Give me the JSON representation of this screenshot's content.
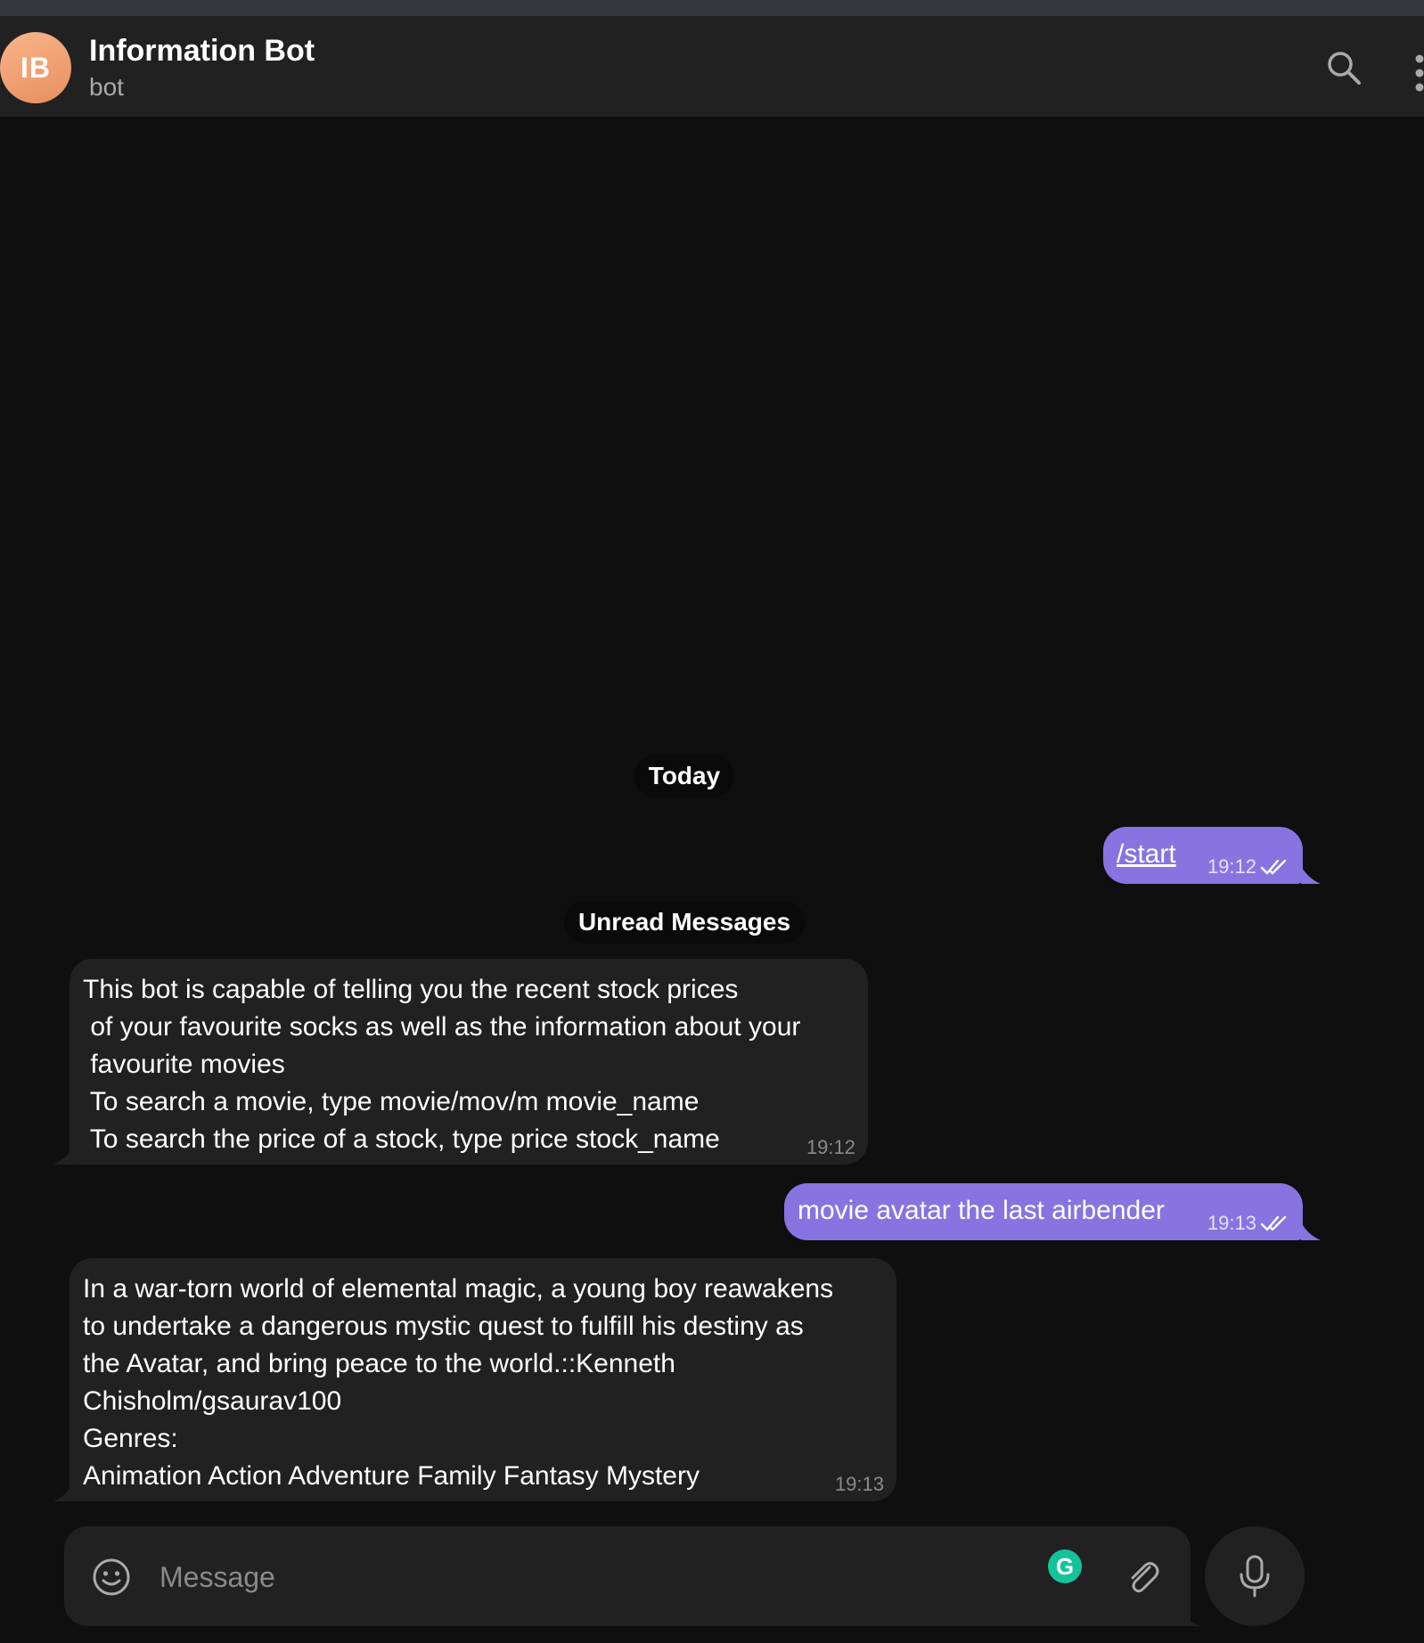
{
  "header": {
    "avatar_initials": "IB",
    "title": "Information Bot",
    "subtitle": "bot",
    "icons": [
      "search-icon",
      "more-vertical-icon"
    ]
  },
  "messages": {
    "date_label": "Today",
    "unread_label": "Unread Messages",
    "items": [
      {
        "direction": "outgoing",
        "text": "/start",
        "time": "19:12",
        "status": "read"
      },
      {
        "direction": "incoming",
        "text": "This bot is capable of telling you the recent stock prices\n of your favourite socks as well as the information about your\n favourite movies\n To search a movie, type movie/mov/m movie_name\n To search the price of a stock, type price stock_name",
        "time": "19:12"
      },
      {
        "direction": "outgoing",
        "text": "movie avatar the last airbender",
        "time": "19:13",
        "status": "read"
      },
      {
        "direction": "incoming",
        "text": "In a war-torn world of elemental magic, a young boy reawakens\nto undertake a dangerous mystic quest to fulfill his destiny as\nthe Avatar, and bring peace to the world.::Kenneth\nChisholm/gsaurav100\nGenres:\nAnimation Action Adventure Family Fantasy Mystery",
        "time": "19:13"
      }
    ]
  },
  "composer": {
    "placeholder": "Message",
    "value": "",
    "grammarly_letter": "G",
    "icons": [
      "emoji-icon",
      "grammarly-icon",
      "attach-icon",
      "microphone-icon"
    ]
  },
  "colors": {
    "outgoing_bubble": "#8774e1",
    "incoming_bubble": "#212121",
    "background": "#0f0f0f",
    "header": "#212121"
  }
}
